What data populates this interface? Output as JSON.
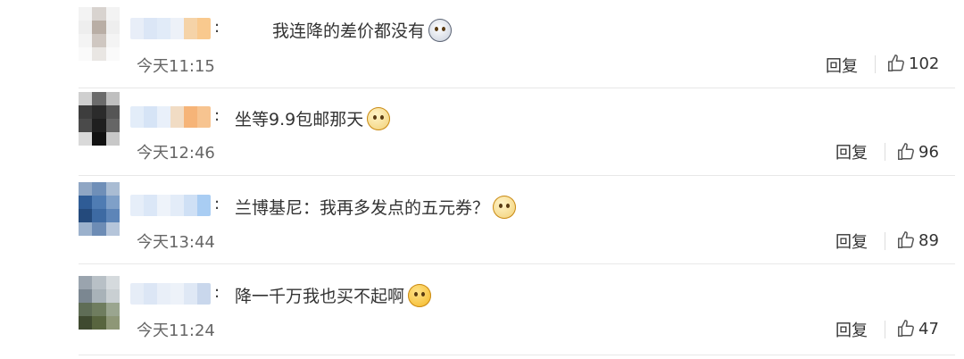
{
  "comments": [
    {
      "text": "我连降的差价都没有",
      "emoji": "ghost-grimace-emoji",
      "time": "今天11:15",
      "reply_label": "回复",
      "likes": "102",
      "avatar_colors": [
        "#f3f3f3",
        "#d8d3cf",
        "#f3f3f3",
        "#eeeeee",
        "#b9aea5",
        "#eeeeee",
        "#f4f4f4",
        "#cfc7c1",
        "#f4f4f4",
        "#fafafa",
        "#e9e6e3",
        "#fafafa"
      ],
      "name_colors": [
        "#e8eef8",
        "#dbe6f6",
        "#e1ebf8",
        "#edf1f8",
        "#f5d3a8",
        "#f9c98e"
      ]
    },
    {
      "text": "坐等9.9包邮那天",
      "emoji": "doge-emoji",
      "time": "今天12:46",
      "reply_label": "回复",
      "likes": "96",
      "avatar_colors": [
        "#cfcfcf",
        "#6b6b6b",
        "#bfbfbf",
        "#3d3d3d",
        "#2b2b2b",
        "#555555",
        "#4a4a4a",
        "#1f1f1f",
        "#666666",
        "#d9d9d9",
        "#111111",
        "#c8c8c8"
      ],
      "name_colors": [
        "#e3edf9",
        "#d6e4f6",
        "#e9f0fa",
        "#f1dcc4",
        "#f6b478",
        "#f7c490"
      ]
    },
    {
      "text": "兰博基尼：我再多发点的五元券？",
      "emoji": "doge-emoji",
      "time": "今天13:44",
      "reply_label": "回复",
      "likes": "89",
      "avatar_colors": [
        "#8fa6c4",
        "#6f8fb8",
        "#a9bcd3",
        "#2f5c96",
        "#4f7cb3",
        "#7fa0c8",
        "#244a7c",
        "#3d6aa3",
        "#5d85b8",
        "#9bb1cc",
        "#6d8cb5",
        "#b5c5da"
      ],
      "name_colors": [
        "#e6eef9",
        "#dbe7f7",
        "#eef3fa",
        "#e3ecf8",
        "#cfe0f5",
        "#a9cdf3"
      ]
    },
    {
      "text": "降一千万我也买不起啊",
      "emoji": "smirk-emoji",
      "time": "今天11:24",
      "reply_label": "回复",
      "likes": "47",
      "avatar_colors": [
        "#9aa4ae",
        "#b8c0c6",
        "#d5dadd",
        "#7b8791",
        "#a8b2b8",
        "#c9cfd2",
        "#5f6d56",
        "#6f7d5f",
        "#9aa58f",
        "#3f4a30",
        "#58653f",
        "#8e9777"
      ],
      "name_colors": [
        "#e6edf7",
        "#dce6f5",
        "#e9eff8",
        "#edf2f9",
        "#dfe8f5",
        "#c9d7ec"
      ]
    }
  ]
}
